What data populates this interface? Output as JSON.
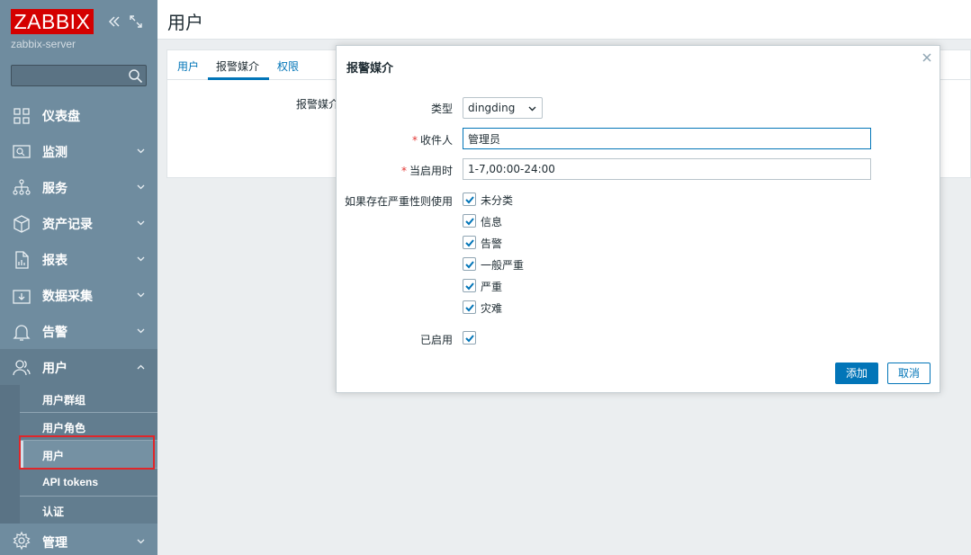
{
  "sidebar": {
    "logo": "ZABBIX",
    "server_name": "zabbix-server",
    "search_placeholder": "",
    "items": [
      {
        "label": "仪表盘",
        "icon": "dashboard-icon"
      },
      {
        "label": "监测",
        "icon": "monitoring-icon"
      },
      {
        "label": "服务",
        "icon": "services-icon"
      },
      {
        "label": "资产记录",
        "icon": "inventory-icon"
      },
      {
        "label": "报表",
        "icon": "reports-icon"
      },
      {
        "label": "数据采集",
        "icon": "data-collection-icon"
      },
      {
        "label": "告警",
        "icon": "alerts-icon"
      },
      {
        "label": "用户",
        "icon": "users-icon"
      },
      {
        "label": "管理",
        "icon": "administration-icon"
      }
    ],
    "users_submenu": [
      {
        "label": "用户群组"
      },
      {
        "label": "用户角色"
      },
      {
        "label": "用户"
      },
      {
        "label": "API tokens"
      },
      {
        "label": "认证"
      }
    ]
  },
  "page": {
    "title": "用户",
    "tabs": [
      {
        "label": "用户"
      },
      {
        "label": "报警媒介"
      },
      {
        "label": "权限"
      }
    ],
    "bg_field_label": "报警媒介"
  },
  "modal": {
    "title": "报警媒介",
    "type_label": "类型",
    "type_value": "dingding",
    "sendto_label": "收件人",
    "sendto_value": "管理员",
    "period_label": "当启用时",
    "period_value": "1-7,00:00-24:00",
    "severity_label": "如果存在严重性则使用",
    "severities": [
      {
        "label": "未分类",
        "checked": true
      },
      {
        "label": "信息",
        "checked": true
      },
      {
        "label": "告警",
        "checked": true
      },
      {
        "label": "一般严重",
        "checked": true
      },
      {
        "label": "严重",
        "checked": true
      },
      {
        "label": "灾难",
        "checked": true
      }
    ],
    "enabled_label": "已启用",
    "enabled": true,
    "add_button": "添加",
    "cancel_button": "取消"
  },
  "colors": {
    "sidebar_bg": "#6f8c9f",
    "accent": "#0275b8",
    "logo_bg": "#d40000",
    "required": "#e33734",
    "highlight": "#e0262a"
  }
}
